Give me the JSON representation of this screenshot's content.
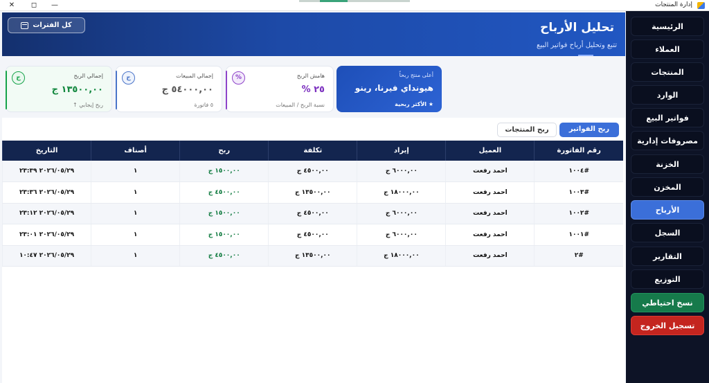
{
  "window": {
    "title": "إدارة المنتجات",
    "minimize": "—",
    "maximize": "◻",
    "close": "✕"
  },
  "header": {
    "title": "تحليل الأرباح",
    "subtitle": "تتبع وتحليل أرباح فواتير البيع",
    "period_button": "كل الفترات"
  },
  "sidebar": {
    "items": [
      {
        "label": "الرئيسية",
        "state": "normal"
      },
      {
        "label": "العملاء",
        "state": "normal"
      },
      {
        "label": "المنتجات",
        "state": "normal"
      },
      {
        "label": "الوارد",
        "state": "normal"
      },
      {
        "label": "فواتير البيع",
        "state": "normal"
      },
      {
        "label": "مصروفات إدارية",
        "state": "normal"
      },
      {
        "label": "الخزنة",
        "state": "normal"
      },
      {
        "label": "المخزن",
        "state": "normal"
      },
      {
        "label": "الأرباح",
        "state": "active"
      },
      {
        "label": "السجل",
        "state": "normal"
      },
      {
        "label": "التقارير",
        "state": "normal"
      },
      {
        "label": "التوزيع",
        "state": "normal"
      },
      {
        "label": "نسخ احتياطي",
        "state": "backup"
      },
      {
        "label": "تسجيل الخروج",
        "state": "logout"
      }
    ]
  },
  "cards": {
    "top_product": {
      "label": "أعلى منتج ربحاً",
      "value": "هيونداي فيرنا، رينو",
      "sub": "★ الأكثر ربحية"
    },
    "margin": {
      "label": "هامش الربح",
      "value": "٢٥ %",
      "sub": "نسبة الربح / المبيعات",
      "badge": "%",
      "color": "#8e44c9"
    },
    "sales": {
      "label": "إجمالي المبيعات",
      "value": "٥٤٠٠٠,٠٠ ج",
      "sub": "٥ فاتورة",
      "badge": "ج",
      "color": "#4a74c9"
    },
    "profit": {
      "label": "إجمالي الربح",
      "value": "١٣٥٠٠,٠٠ ج",
      "sub": "ربح إيجابي ↑",
      "badge": "ج",
      "color": "#16a34a"
    }
  },
  "tabs": {
    "invoice_profit": "ربح الفواتير",
    "product_profit": "ربح المنتجات"
  },
  "table": {
    "headers": [
      "رقم الفاتورة",
      "العميل",
      "إيراد",
      "تكلفة",
      "ربح",
      "أصناف",
      "التاريخ"
    ],
    "rows": [
      [
        "#١٠٠٤",
        "احمد رفعت",
        "٦٠٠٠,٠٠ ج",
        "٤٥٠٠,٠٠ ج",
        "١٥٠٠,٠٠ ج",
        "١",
        "٢٠٢٦/٠٥/٢٩ ٢٣:٣٩"
      ],
      [
        "#١٠٠٣",
        "احمد رفعت",
        "١٨٠٠٠,٠٠ ج",
        "١٣٥٠٠,٠٠ ج",
        "٤٥٠٠,٠٠ ج",
        "١",
        "٢٠٢٦/٠٥/٢٩ ٢٣:٣٦"
      ],
      [
        "#١٠٠٢",
        "احمد رفعت",
        "٦٠٠٠,٠٠ ج",
        "٤٥٠٠,٠٠ ج",
        "١٥٠٠,٠٠ ج",
        "١",
        "٢٠٢٦/٠٥/٢٩ ٢٣:١٢"
      ],
      [
        "#١٠٠١",
        "احمد رفعت",
        "٦٠٠٠,٠٠ ج",
        "٤٥٠٠,٠٠ ج",
        "١٥٠٠,٠٠ ج",
        "١",
        "٢٠٢٦/٠٥/٢٩ ٢٣:٠١"
      ],
      [
        "#٢",
        "احمد رفعت",
        "١٨٠٠٠,٠٠ ج",
        "١٣٥٠٠,٠٠ ج",
        "٤٥٠٠,٠٠ ج",
        "١",
        "٢٠٢٦/٠٥/٢٩ ١٠:٤٧"
      ]
    ]
  }
}
